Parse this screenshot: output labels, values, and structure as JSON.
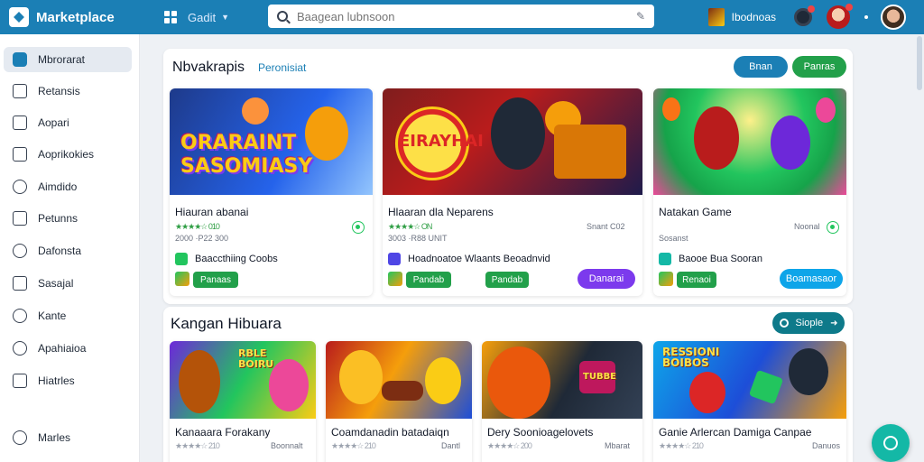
{
  "app": {
    "title": "Marketplace"
  },
  "header": {
    "category_label": "Gadit",
    "search_placeholder": "Baagean lubnsoon",
    "user_name": "Ibodnoas"
  },
  "sidebar": {
    "items": [
      {
        "label": "Mbrorarat"
      },
      {
        "label": "Retansis"
      },
      {
        "label": "Aopari"
      },
      {
        "label": "Aoprikokies"
      },
      {
        "label": "Aimdido"
      },
      {
        "label": "Petunns"
      },
      {
        "label": "Dafonsta"
      },
      {
        "label": "Sasajal"
      },
      {
        "label": "Kante"
      },
      {
        "label": "Apahiaioa"
      },
      {
        "label": "Hiatrles"
      }
    ],
    "footer_label": "Marles"
  },
  "section1": {
    "title": "Nbvakrapis",
    "link": "Peronisiat",
    "btn_primary": "Bnan",
    "btn_secondary": "Panras",
    "cards": [
      {
        "art_text": "ORARAINT SASOMIASY",
        "title": "Hiauran abanai",
        "rating": "★★★★☆ 010",
        "meta": "2000 ·P22 300",
        "side": "",
        "dev": "Baaccthiing Coobs",
        "tag": "Panaas",
        "action": ""
      },
      {
        "art_text": "EIRAYHAI",
        "title": "Hlaaran dla Neparens",
        "rating": "★★★★☆ ON",
        "meta": "3003 ·R88 UNIT",
        "side": "Snant C02",
        "dev": "Hoadnoatoe Wlaants Beoadnvid",
        "tag": "Pandab",
        "action": "Danarai"
      },
      {
        "art_text": "",
        "title": "Natakan Game",
        "rating": "",
        "meta": "Sosanst",
        "side": "Noonal",
        "dev": "Baooe Bua Sooran",
        "tag": "Renaoi",
        "action": "Boamasaor"
      }
    ]
  },
  "section2": {
    "title": "Kangan Hibuara",
    "btn": "Siople",
    "cards": [
      {
        "art_text": "RBLE BOIRU",
        "title": "Kanaaara Forakany",
        "rating": "★★★★☆ 210",
        "side": "Boonnalt"
      },
      {
        "art_text": "",
        "title": "Coamdanadin batadaiqn",
        "rating": "★★★★☆ 210",
        "side": "Dantl"
      },
      {
        "art_text": "TUBBE",
        "title": "Dery Soonioagelovets",
        "rating": "★★★★☆ 200",
        "side": "Mbarat"
      },
      {
        "art_text": "RESSIONI BOIBOS",
        "title": "Ganie Arlercan Damiga Canpae",
        "rating": "★★★★☆ 210",
        "side": "Danuos"
      }
    ]
  },
  "colors": {
    "brand": "#1b7fb5",
    "accent_green": "#22a04a",
    "accent_purple": "#7c3aed",
    "accent_teal": "#14b8a6"
  }
}
